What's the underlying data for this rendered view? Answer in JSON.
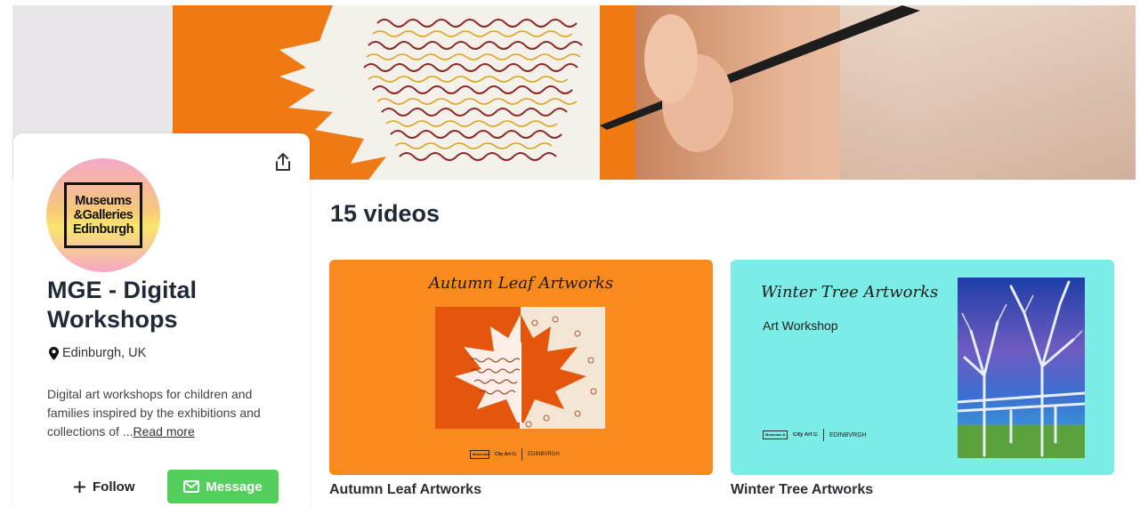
{
  "profile": {
    "logo_text": "Museums\n&Galleries\nEdinburgh",
    "name": "MGE - Digital Workshops",
    "location": "Edinburgh, UK",
    "about": "Digital art workshops for children and families inspired by the exhibitions and collections of ...",
    "read_more": "Read more",
    "follow_label": "Follow",
    "message_label": "Message"
  },
  "videos": {
    "count_label": "15 videos",
    "items": [
      {
        "title": "Autumn Leaf Artworks",
        "thumb_title": "Autumn Leaf Artworks",
        "thumb_logo_a": "Museums & Galleries Edinburgh",
        "thumb_logo_b": "City Art Centre",
        "thumb_logo_c": "EDINBVRGH"
      },
      {
        "title": "Winter Tree Artworks",
        "thumb_title": "Winter Tree Artworks",
        "thumb_subtitle": "Art Workshop",
        "thumb_logo_a": "Museums & Galleries Edinburgh",
        "thumb_logo_b": "City Art Centre",
        "thumb_logo_c": "EDINBVRGH"
      }
    ]
  },
  "colors": {
    "message_button": "#54cf5d",
    "autumn_bg": "#f98a1d",
    "winter_bg": "#7bece6"
  },
  "icons": [
    "share-icon",
    "location-pin-icon",
    "plus-icon",
    "envelope-icon"
  ]
}
